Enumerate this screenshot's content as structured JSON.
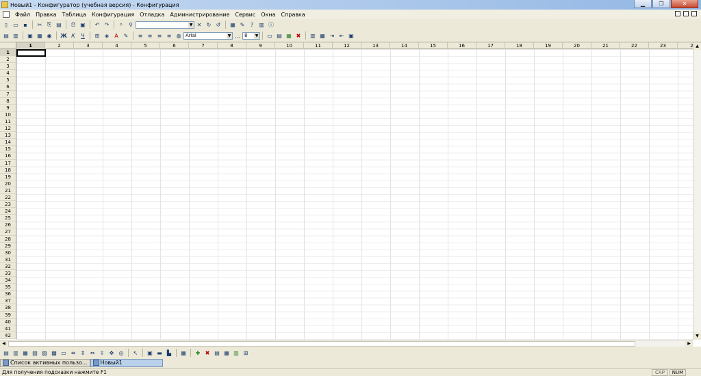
{
  "window": {
    "title": "Новый1 - Конфигуратор (учебная версия) - Конфигурация"
  },
  "menu": [
    "Файл",
    "Правка",
    "Таблица",
    "Конфигурация",
    "Отладка",
    "Администрирование",
    "Сервис",
    "Окна",
    "Справка"
  ],
  "toolbar": {
    "font_name": "Arial",
    "font_size": "8",
    "search_value": ""
  },
  "sheet": {
    "columns": [
      "1",
      "2",
      "3",
      "4",
      "5",
      "6",
      "7",
      "8",
      "9",
      "10",
      "11",
      "12",
      "13",
      "14",
      "15",
      "16",
      "17",
      "18",
      "19",
      "20",
      "21",
      "22",
      "23",
      "2"
    ],
    "rows": [
      "1",
      "2",
      "3",
      "4",
      "5",
      "6",
      "7",
      "8",
      "9",
      "10",
      "11",
      "12",
      "13",
      "14",
      "15",
      "16",
      "17",
      "18",
      "19",
      "20",
      "21",
      "22",
      "23",
      "24",
      "25",
      "26",
      "27",
      "28",
      "29",
      "30",
      "31",
      "32",
      "33",
      "34",
      "35",
      "36",
      "37",
      "38",
      "39",
      "40",
      "41",
      "42"
    ],
    "active_column": "1",
    "active_row": "1"
  },
  "windows": [
    {
      "label": "Список активных пользо...",
      "active": false
    },
    {
      "label": "Новый1",
      "active": true
    }
  ],
  "status": {
    "hint": "Для получения подсказки нажмите F1",
    "cap": "CAP",
    "num": "NUM"
  }
}
